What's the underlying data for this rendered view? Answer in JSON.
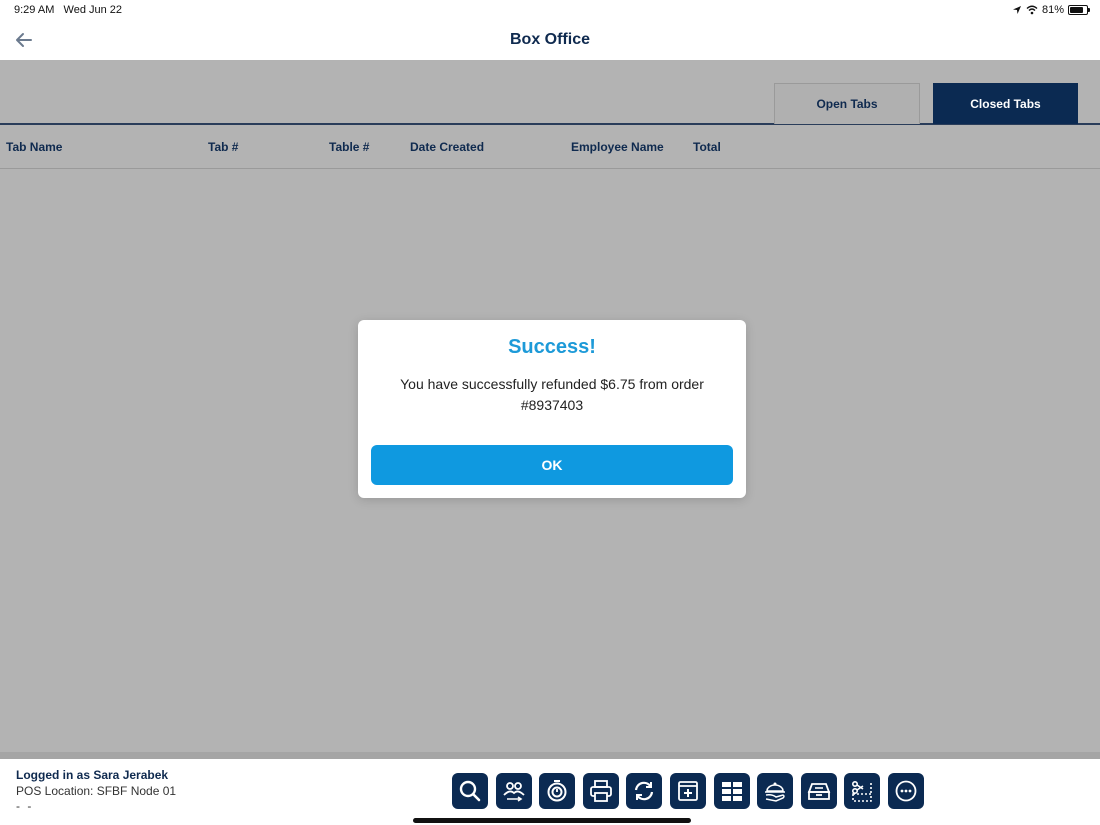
{
  "status_bar": {
    "time": "9:29 AM",
    "date": "Wed Jun 22",
    "battery": "81%",
    "battery_level": 0.81
  },
  "header": {
    "title": "Box Office",
    "back_icon": "arrow-left-icon"
  },
  "tabs": {
    "open_label": "Open Tabs",
    "closed_label": "Closed Tabs",
    "active": "closed"
  },
  "table": {
    "columns": [
      "Tab Name",
      "Tab #",
      "Table #",
      "Date Created",
      "Employee Name",
      "Total"
    ],
    "rows": []
  },
  "footer": {
    "user": "Logged in as Sara Jerabek",
    "location": "POS Location: SFBF Node 01",
    "extra": "- -"
  },
  "toolbar_icons": [
    "search-icon",
    "customers-icon",
    "timer-icon",
    "print-icon",
    "refresh-icon",
    "add-tab-icon",
    "grid-icon",
    "food-service-icon",
    "cash-drawer-icon",
    "cut-ticket-icon",
    "more-icon"
  ],
  "modal": {
    "title": "Success!",
    "message": "You have successfully refunded $6.75 from order #8937403",
    "ok_label": "OK"
  },
  "colors": {
    "navy": "#0b2a52",
    "accent": "#1d9ad8",
    "ok_button": "#0f99e0",
    "overlay_gray": "#b3b3b3"
  }
}
